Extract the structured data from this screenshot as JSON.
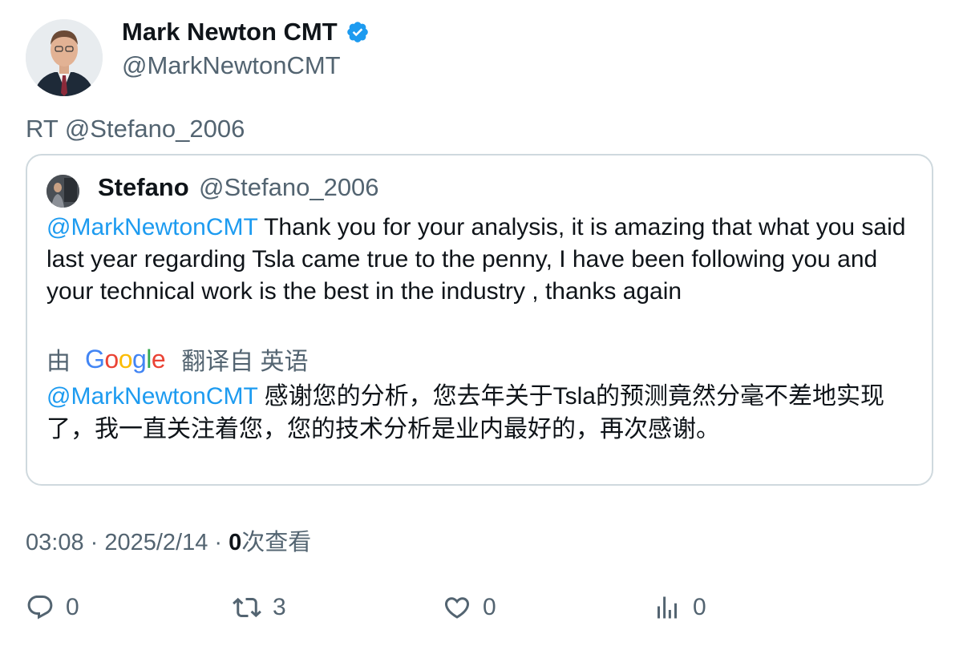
{
  "author": {
    "name": "Mark Newton CMT",
    "handle": "@MarkNewtonCMT",
    "verified_color": "#1d9bf0"
  },
  "retweet_line": "RT @Stefano_2006",
  "quoted": {
    "name": "Stefano",
    "handle": "@Stefano_2006",
    "mention": "@MarkNewtonCMT",
    "text": " Thank you for your analysis, it is amazing that what you said last year regarding Tsla came true to the penny, I have been following you and your technical work is the best in the industry , thanks again",
    "translate_prefix": "由",
    "translate_brand": "Google",
    "translate_suffix": "翻译自 英语",
    "translated_mention": "@MarkNewtonCMT",
    "translated_text": " 感谢您的分析，您去年关于Tsla的预测竟然分毫不差地实现了，我一直关注着您，您的技术分析是业内最好的，再次感谢。"
  },
  "meta": {
    "time": "03:08",
    "sep1": " · ",
    "date": "2025/2/14",
    "sep2": " · ",
    "views_count": "0",
    "views_label": "次查看"
  },
  "actions": {
    "replies": "0",
    "retweets": "3",
    "likes": "0",
    "views": "0"
  },
  "colors": {
    "link": "#1d9bf0",
    "secondary_text": "#536471",
    "border": "#cfd9de"
  }
}
